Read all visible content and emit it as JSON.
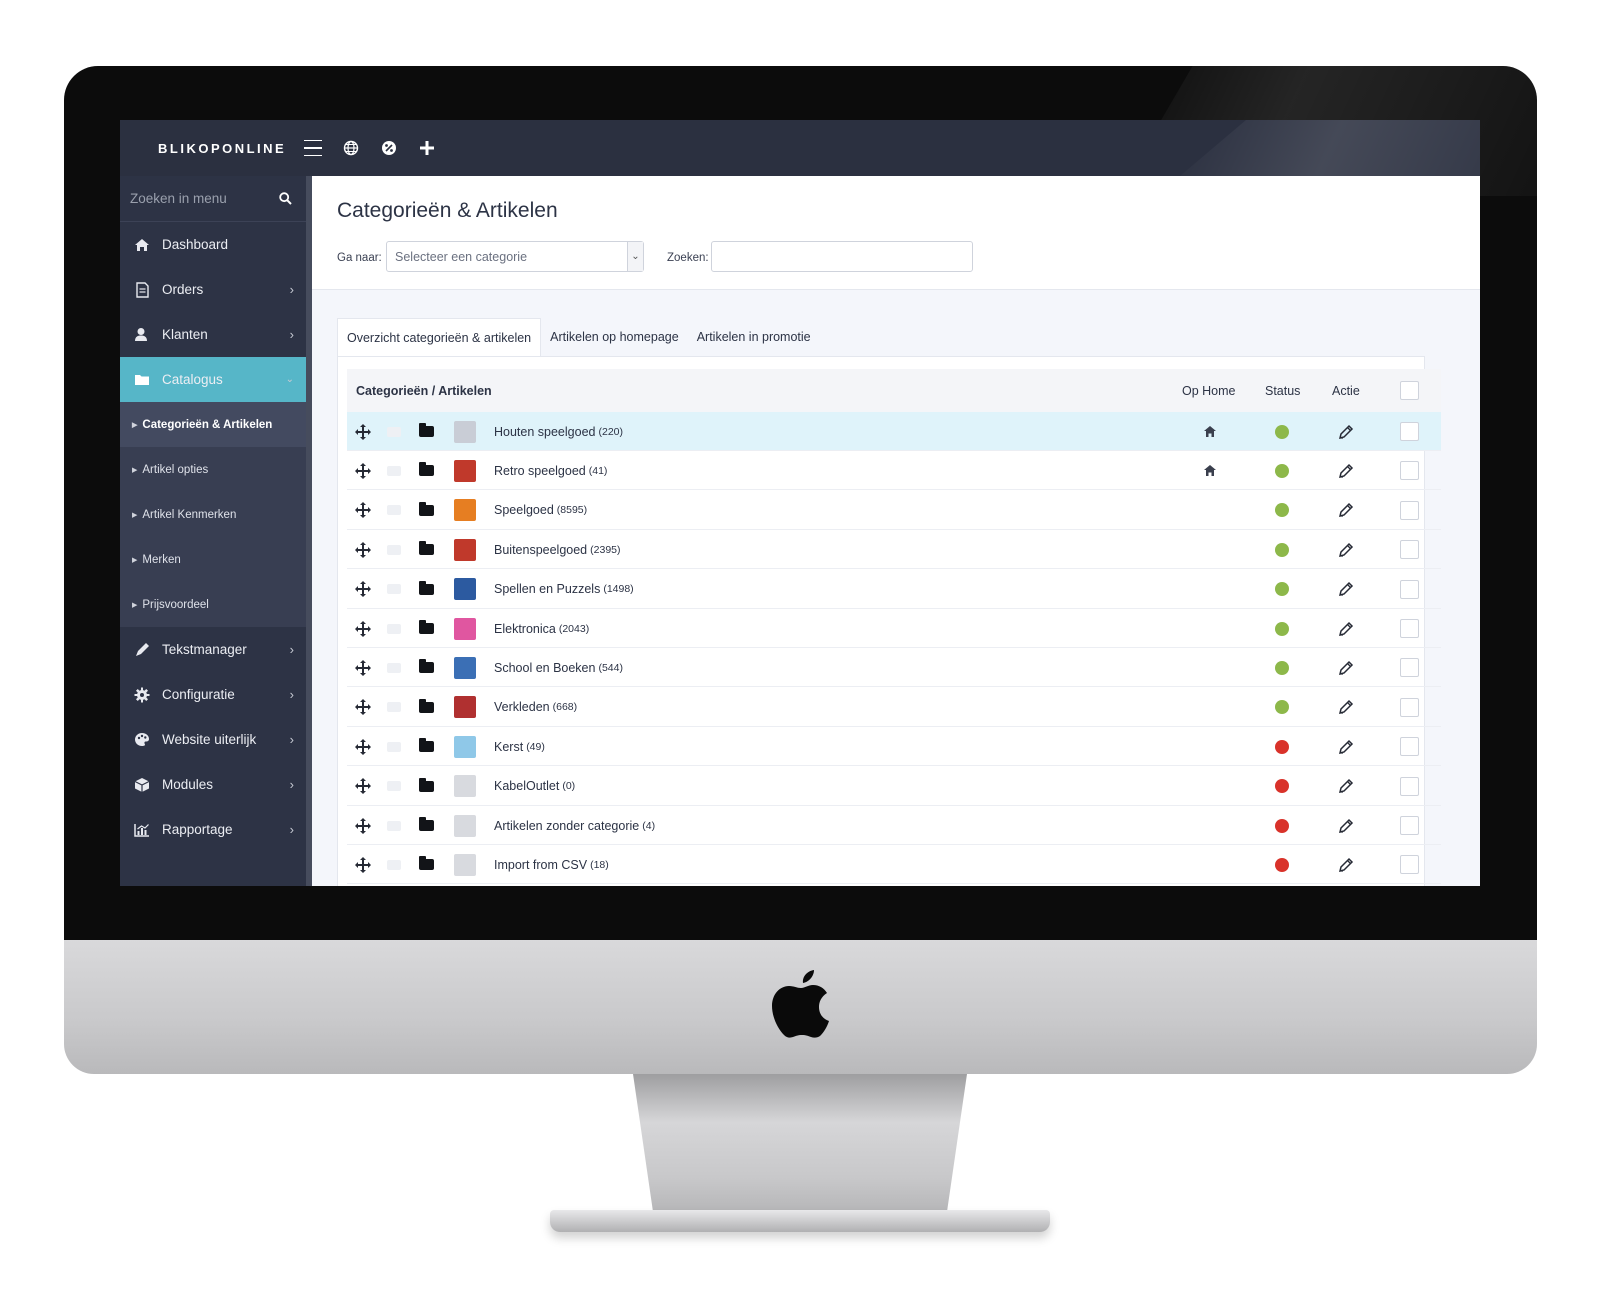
{
  "topbar": {
    "logo": "BLIKOPONLINE",
    "icons": [
      "menu-icon",
      "globe-icon",
      "percent-icon",
      "plus-icon"
    ]
  },
  "sidebar": {
    "search_placeholder": "Zoeken in menu",
    "items": [
      {
        "label": "Dashboard",
        "icon": "home-icon"
      },
      {
        "label": "Orders",
        "icon": "document-icon"
      },
      {
        "label": "Klanten",
        "icon": "user-icon"
      },
      {
        "label": "Catalogus",
        "icon": "folder-icon"
      },
      {
        "label": "Tekstmanager",
        "icon": "pen-icon"
      },
      {
        "label": "Configuratie",
        "icon": "gear-icon"
      },
      {
        "label": "Website uiterlijk",
        "icon": "palette-icon"
      },
      {
        "label": "Modules",
        "icon": "cube-icon"
      },
      {
        "label": "Rapportage",
        "icon": "chart-icon"
      }
    ],
    "sub_items": [
      {
        "label": "Categorieën & Artikelen"
      },
      {
        "label": "Artikel opties"
      },
      {
        "label": "Artikel Kenmerken"
      },
      {
        "label": "Merken"
      },
      {
        "label": "Prijsvoordeel"
      }
    ]
  },
  "main": {
    "title": "Categorieën & Artikelen",
    "goto_label": "Ga naar:",
    "goto_placeholder": "Selecteer een categorie",
    "search_label": "Zoeken:",
    "tabs": [
      {
        "label": "Overzicht categorieën & artikelen"
      },
      {
        "label": "Artikelen op homepage"
      },
      {
        "label": "Artikelen in promotie"
      }
    ]
  },
  "table": {
    "headers": {
      "main": "Categorieën / Artikelen",
      "home": "Op Home",
      "status": "Status",
      "actie": "Actie"
    },
    "colors": {
      "active": "#8db84a",
      "inactive": "#d9322a",
      "highlight": "#dff3fa",
      "accent": "#56b6c8"
    },
    "rows": [
      {
        "name": "Houten speelgoed",
        "count": "(220)",
        "home": true,
        "status": "active",
        "thumb": "#c9cdd6"
      },
      {
        "name": "Retro speelgoed",
        "count": "(41)",
        "home": true,
        "status": "active",
        "thumb": "#c0392b"
      },
      {
        "name": "Speelgoed",
        "count": "(8595)",
        "home": false,
        "status": "active",
        "thumb": "#e67e22"
      },
      {
        "name": "Buitenspeelgoed",
        "count": "(2395)",
        "home": false,
        "status": "active",
        "thumb": "#c0392b"
      },
      {
        "name": "Spellen en Puzzels",
        "count": "(1498)",
        "home": false,
        "status": "active",
        "thumb": "#2c5aa0"
      },
      {
        "name": "Elektronica",
        "count": "(2043)",
        "home": false,
        "status": "active",
        "thumb": "#e056a0"
      },
      {
        "name": "School en Boeken",
        "count": "(544)",
        "home": false,
        "status": "active",
        "thumb": "#3b6fb5"
      },
      {
        "name": "Verkleden",
        "count": "(668)",
        "home": false,
        "status": "active",
        "thumb": "#b03030"
      },
      {
        "name": "Kerst",
        "count": "(49)",
        "home": false,
        "status": "inactive",
        "thumb": "#8fc8e8"
      },
      {
        "name": "KabelOutlet",
        "count": "(0)",
        "home": false,
        "status": "inactive",
        "thumb": "#d8dadf"
      },
      {
        "name": "Artikelen zonder categorie",
        "count": "(4)",
        "home": false,
        "status": "inactive",
        "thumb": "#d8dadf"
      },
      {
        "name": "Import from CSV",
        "count": "(18)",
        "home": false,
        "status": "inactive",
        "thumb": "#d8dadf"
      }
    ]
  }
}
